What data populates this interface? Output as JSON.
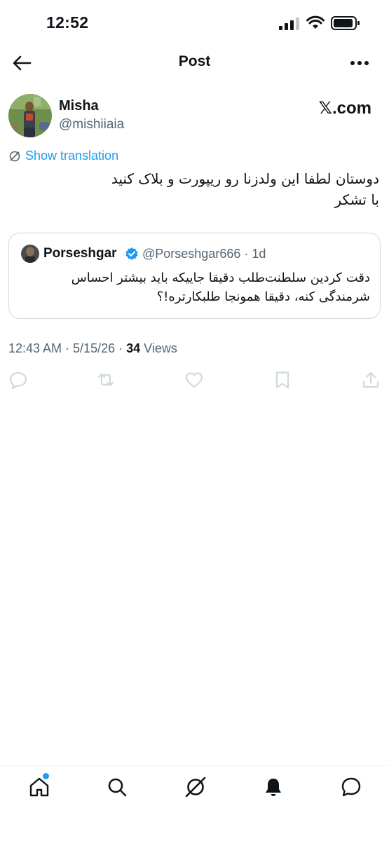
{
  "status_bar": {
    "time": "12:52"
  },
  "header": {
    "title": "Post"
  },
  "post": {
    "author_name": "Misha",
    "author_handle": "@mishiiaia",
    "brand": "𝕏.com",
    "translation_label": "Show translation",
    "text_line1": "دوستان لطفا این ولدزنا رو ریپورت و بلاک کنید",
    "text_line2": "با تشکر",
    "timestamp": "12:43 AM · 5/15/26 · ",
    "views_count": "34",
    "views_label": " Views"
  },
  "quote": {
    "author_name": "Porseshgar",
    "author_handle": "@Porseshgar666 · 1d",
    "text": "دقت کردین سلطنت‌طلب دقیقا جاییکه باید بیشتر احساس شرمندگی کنه، دقیقا همونجا طلبکارتره!؟"
  },
  "actions": [
    "reply-icon",
    "repost-icon",
    "like-icon",
    "bookmark-icon",
    "share-icon"
  ],
  "nav": [
    "home-icon",
    "search-icon",
    "grok-icon",
    "notifications-icon",
    "messages-icon"
  ],
  "colors": {
    "accent": "#1d9bf0",
    "secondary_text": "#536471",
    "action_icon": "#cfd9de"
  }
}
